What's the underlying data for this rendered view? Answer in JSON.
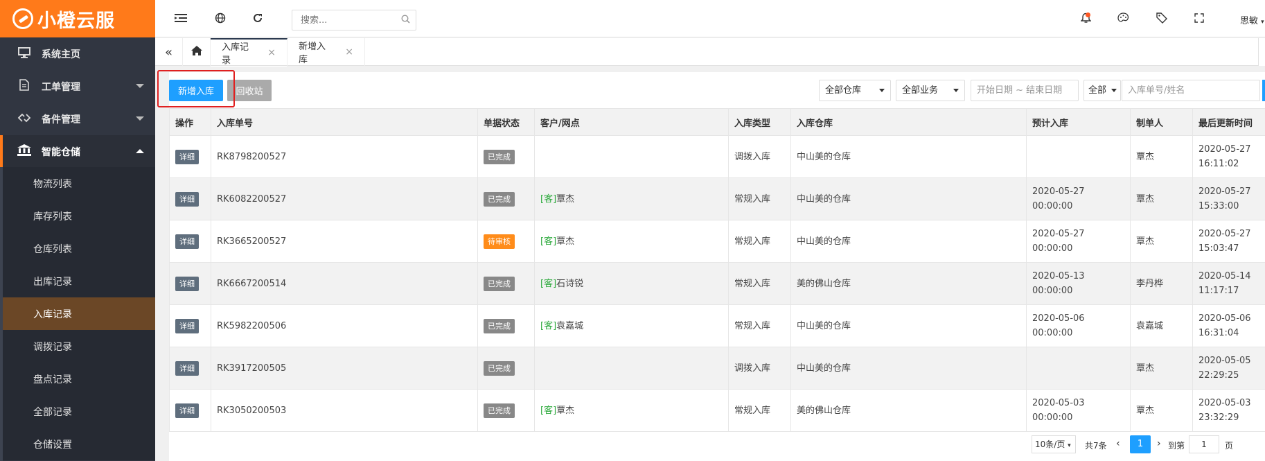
{
  "brand": {
    "name": "小橙云服"
  },
  "sidebar": {
    "items": [
      {
        "label": "系统主页",
        "icon": "monitor-icon"
      },
      {
        "label": "工单管理",
        "icon": "document-icon"
      },
      {
        "label": "备件管理",
        "icon": "diamond-link-icon"
      },
      {
        "label": "智能仓储",
        "icon": "bank-icon"
      }
    ],
    "subitems": [
      {
        "label": "物流列表"
      },
      {
        "label": "库存列表"
      },
      {
        "label": "仓库列表"
      },
      {
        "label": "出库记录"
      },
      {
        "label": "入库记录"
      },
      {
        "label": "调拨记录"
      },
      {
        "label": "盘点记录"
      },
      {
        "label": "全部记录"
      },
      {
        "label": "仓储设置"
      }
    ]
  },
  "header": {
    "search_placeholder": "搜索...",
    "user": "思敏"
  },
  "tabs": [
    {
      "label": "入库记录",
      "close": "×"
    },
    {
      "label": "新增入库",
      "close": "×"
    }
  ],
  "toolbar": {
    "add_label": "新增入库",
    "recycle_label": "回收站",
    "warehouse_select": "全部仓库",
    "business_select": "全部业务",
    "date_placeholder": "开始日期 ~ 结束日期",
    "scope_select": "全部",
    "keyword_placeholder": "入库单号/姓名"
  },
  "table": {
    "headers": [
      "操作",
      "入库单号",
      "单据状态",
      "客户/网点",
      "入库类型",
      "入库仓库",
      "预计入库",
      "制单人",
      "最后更新时间"
    ],
    "detail_label": "详细",
    "rows": [
      {
        "no": "RK8798200527",
        "status": "已完成",
        "tag": "",
        "customer": "",
        "type": "调拨入库",
        "warehouse": "中山美的仓库",
        "expect_date": "",
        "expect_time": "",
        "maker": "覃杰",
        "update_date": "2020-05-27",
        "update_time": "16:11:02"
      },
      {
        "no": "RK6082200527",
        "status": "已完成",
        "tag": "[客]",
        "customer": "覃杰",
        "type": "常规入库",
        "warehouse": "中山美的仓库",
        "expect_date": "2020-05-27",
        "expect_time": "00:00:00",
        "maker": "覃杰",
        "update_date": "2020-05-27",
        "update_time": "15:33:00"
      },
      {
        "no": "RK3665200527",
        "status": "待审核",
        "tag": "[客]",
        "customer": "覃杰",
        "type": "常规入库",
        "warehouse": "中山美的仓库",
        "expect_date": "2020-05-27",
        "expect_time": "00:00:00",
        "maker": "覃杰",
        "update_date": "2020-05-27",
        "update_time": "15:03:47"
      },
      {
        "no": "RK6667200514",
        "status": "已完成",
        "tag": "[客]",
        "customer": "石诗锐",
        "type": "常规入库",
        "warehouse": "美的佛山仓库",
        "expect_date": "2020-05-13",
        "expect_time": "00:00:00",
        "maker": "李丹桦",
        "update_date": "2020-05-14",
        "update_time": "11:17:17"
      },
      {
        "no": "RK5982200506",
        "status": "已完成",
        "tag": "[客]",
        "customer": "袁嘉城",
        "type": "常规入库",
        "warehouse": "中山美的仓库",
        "expect_date": "2020-05-06",
        "expect_time": "00:00:00",
        "maker": "袁嘉城",
        "update_date": "2020-05-06",
        "update_time": "16:31:04"
      },
      {
        "no": "RK3917200505",
        "status": "已完成",
        "tag": "",
        "customer": "",
        "type": "调拨入库",
        "warehouse": "中山美的仓库",
        "expect_date": "",
        "expect_time": "",
        "maker": "覃杰",
        "update_date": "2020-05-05",
        "update_time": "22:29:25"
      },
      {
        "no": "RK3050200503",
        "status": "已完成",
        "tag": "[客]",
        "customer": "覃杰",
        "type": "常规入库",
        "warehouse": "美的佛山仓库",
        "expect_date": "2020-05-03",
        "expect_time": "00:00:00",
        "maker": "覃杰",
        "update_date": "2020-05-03",
        "update_time": "23:32:29"
      }
    ]
  },
  "pager": {
    "page_size": "10条/页",
    "total": "共7条",
    "current": "1",
    "goto_label": "到第",
    "goto_value": "1",
    "page_unit": "页"
  },
  "colors": {
    "brand": "#ff7a1a",
    "sidebar": "#313641",
    "primary": "#1e9fff",
    "active_sub": "#6b4726",
    "pending": "#ff8c1a"
  }
}
